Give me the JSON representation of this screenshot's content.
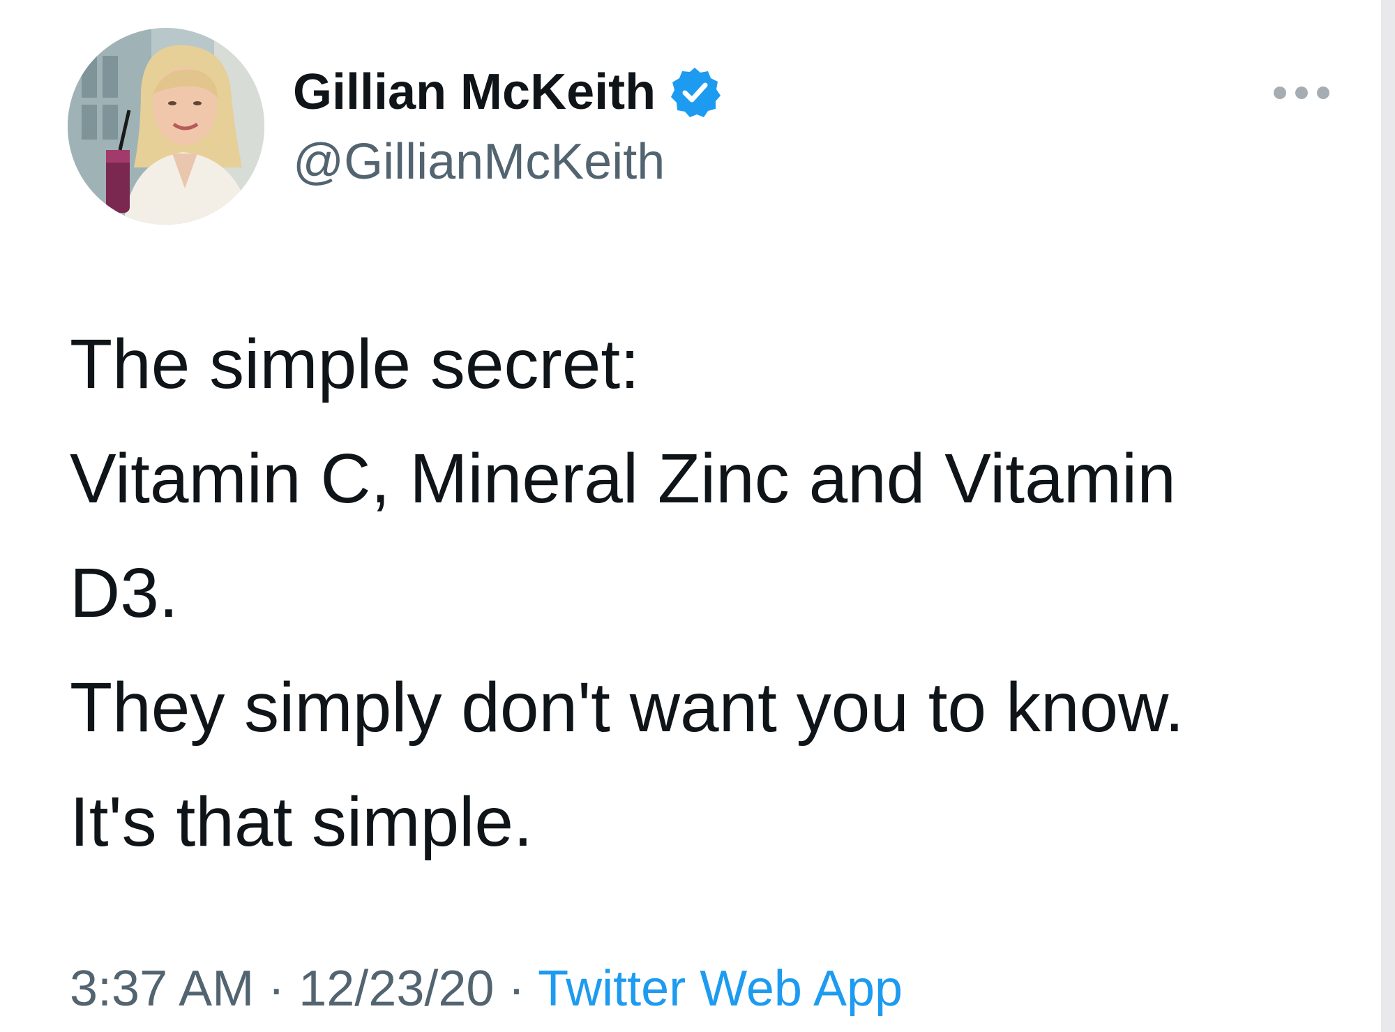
{
  "tweet": {
    "author": {
      "display_name": "Gillian McKeith",
      "handle": "@GillianMcKeith",
      "verified": true,
      "verified_icon": "verified-badge-icon",
      "avatar_icon": "profile-photo"
    },
    "more_icon": "more-dots-icon",
    "text_lines": [
      "The simple secret:",
      "Vitamin C,  Mineral Zinc and Vitamin",
      "D3.",
      "They simply don't want you to know.",
      "It's that simple."
    ],
    "time": "3:37 AM",
    "separator": "·",
    "date": "12/23/20",
    "source": "Twitter Web App"
  },
  "colors": {
    "text_primary": "#0f1419",
    "text_secondary": "#536471",
    "accent_blue": "#1d9bf0",
    "verified_blue": "#1d9bf0",
    "background": "#ffffff"
  }
}
